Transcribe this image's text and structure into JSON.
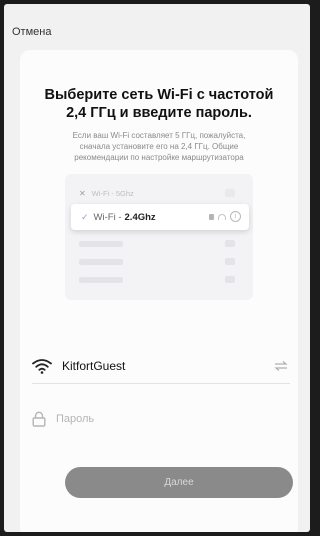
{
  "topbar": {
    "cancel_label": "Отмена"
  },
  "card": {
    "title": "Выберите сеть Wi-Fi с частотой\n2,4 ГГц и введите пароль.",
    "subtitle": "Если ваш Wi-Fi составляет 5 ГГц, пожалуйста,\nсначала установите его на 2,4 ГГц. Общие\nрекомендации по настройке маршрутизатора"
  },
  "illustration": {
    "row_5g": {
      "prefix": "Wi-Fi - ",
      "band": "5Ghz"
    },
    "row_24g": {
      "prefix": "Wi-Fi - ",
      "band": "2.4Ghz"
    }
  },
  "network": {
    "ssid": "KitfortGuest"
  },
  "password": {
    "value": "",
    "placeholder": "Пароль"
  },
  "next_button": {
    "label": "Далее"
  },
  "colors": {
    "background": "#f1f1f1",
    "card": "#fcfcfc",
    "button_disabled": "#8a8a8a",
    "button_text": "#d8d8d8",
    "text_primary": "#111111",
    "text_muted": "#8a8a8a"
  },
  "icons": {
    "cancel": "none",
    "network": "wifi-icon",
    "swap": "swap-arrows-icon",
    "password": "lock-icon",
    "check": "check-icon",
    "close": "x-icon",
    "info": "info-icon"
  }
}
